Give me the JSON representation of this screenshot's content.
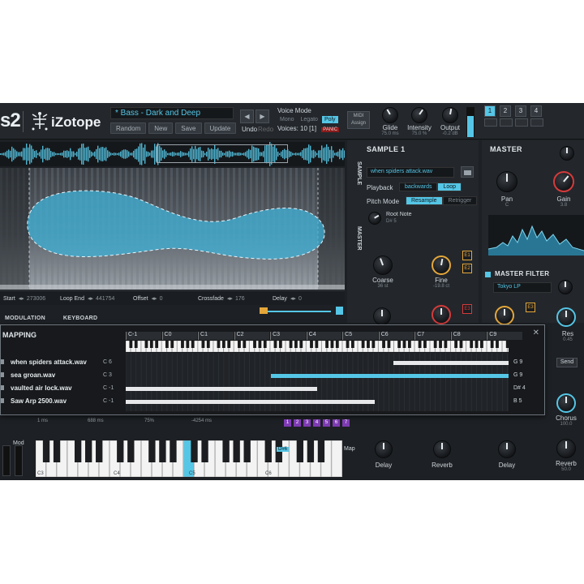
{
  "header": {
    "logo_suffix": "s2",
    "brand": "iZotope",
    "preset_name": "* Bass - Dark and Deep",
    "preset_buttons": [
      "Random",
      "New",
      "Save",
      "Update"
    ],
    "undo_label": "Undo",
    "redo_label": "Redo",
    "voice_mode": {
      "title": "Voice Mode",
      "options": [
        "Mono",
        "Legato",
        "Poly"
      ],
      "selected": "Poly",
      "voices_label": "Voices:",
      "voices_value": "10 [1]",
      "panic_label": "PANIC"
    },
    "midi_assign": [
      "MIDI",
      "Assign"
    ],
    "knobs": [
      {
        "label": "Glide",
        "value": "75.0 ms"
      },
      {
        "label": "Intensity",
        "value": "75.0 %"
      },
      {
        "label": "Output",
        "value": "-0.2 dB"
      }
    ],
    "output_level": 0.75,
    "slots": [
      "1",
      "2",
      "3",
      "4"
    ],
    "active_slot": "1"
  },
  "sample_editor": {
    "params": [
      {
        "label": "Start",
        "value": "273006"
      },
      {
        "label": "Loop End",
        "value": "441754"
      },
      {
        "label": "Offset",
        "value": "0"
      },
      {
        "label": "Crossfade",
        "value": "176"
      },
      {
        "label": "Delay",
        "value": "0"
      }
    ],
    "tabs": [
      "MODULATION",
      "KEYBOARD"
    ]
  },
  "sample_panel": {
    "side_tabs": [
      "SAMPLE",
      "MASTER"
    ],
    "title": "SAMPLE 1",
    "sample_file": "when spiders attack.wav",
    "playback_label": "Playback",
    "playback_options": [
      "backwards",
      "Loop"
    ],
    "pitch_mode_label": "Pitch Mode",
    "pitch_mode_options": [
      "Resample",
      "Retrigger"
    ],
    "root_note_label": "Root Note",
    "root_note_value": "D# 5",
    "knobs": [
      {
        "label": "Coarse",
        "value": "36 st"
      },
      {
        "label": "Fine",
        "value": "-19.8 ct"
      }
    ],
    "badges": [
      "E1",
      "E2",
      "E3"
    ]
  },
  "master_panel": {
    "title": "MASTER",
    "knobs": [
      {
        "label": "Pan",
        "value": "C"
      },
      {
        "label": "Gain",
        "value": "3.8"
      }
    ],
    "filter_title": "MASTER FILTER",
    "filter_type": "Tokyo LP",
    "res_label": "Res",
    "res_value": "0.45",
    "send_label": "Send",
    "chorus_label": "Chorus",
    "chorus_value": "100.0",
    "reverb_label": "Reverb",
    "reverb_value": "50.0",
    "badge": "E3"
  },
  "key_mapping": {
    "title": "MAPPING",
    "octaves": [
      "C-1",
      "C0",
      "C1",
      "C2",
      "C3",
      "C4",
      "C5",
      "C6",
      "C7",
      "C8",
      "C9"
    ],
    "rows": [
      {
        "name": "when spiders attack.wav",
        "key": "C 6",
        "start": 0.7,
        "end": 1.0,
        "end_label": "G 9",
        "selected": false
      },
      {
        "name": "sea groan.wav",
        "key": "C 3",
        "start": 0.38,
        "end": 1.0,
        "end_label": "G 9",
        "selected": true
      },
      {
        "name": "vaulted air lock.wav",
        "key": "C -1",
        "start": 0.0,
        "end": 0.5,
        "end_label": "D# 4",
        "selected": false
      },
      {
        "name": "Saw Arp 2500.wav",
        "key": "C -1",
        "start": 0.0,
        "end": 0.65,
        "end_label": "B 5",
        "selected": false
      }
    ]
  },
  "lower": {
    "mod_label": "Mod",
    "map_label": "Map",
    "note_tag": "D#6",
    "octave_labels": [
      "C3",
      "C4",
      "C5",
      "C6"
    ],
    "env_values": [
      "1 ms",
      "688 ms",
      "75%",
      "-4254 ms"
    ],
    "pads": [
      "1",
      "2",
      "3",
      "4",
      "5",
      "6",
      "7"
    ],
    "bottom_knobs": [
      "Delay",
      "Reverb",
      "Delay",
      "Reverb"
    ]
  },
  "colors": {
    "accent": "#55c6e6",
    "orange": "#e5a73a",
    "red": "#d43b3b",
    "purple": "#7e3bb3"
  }
}
